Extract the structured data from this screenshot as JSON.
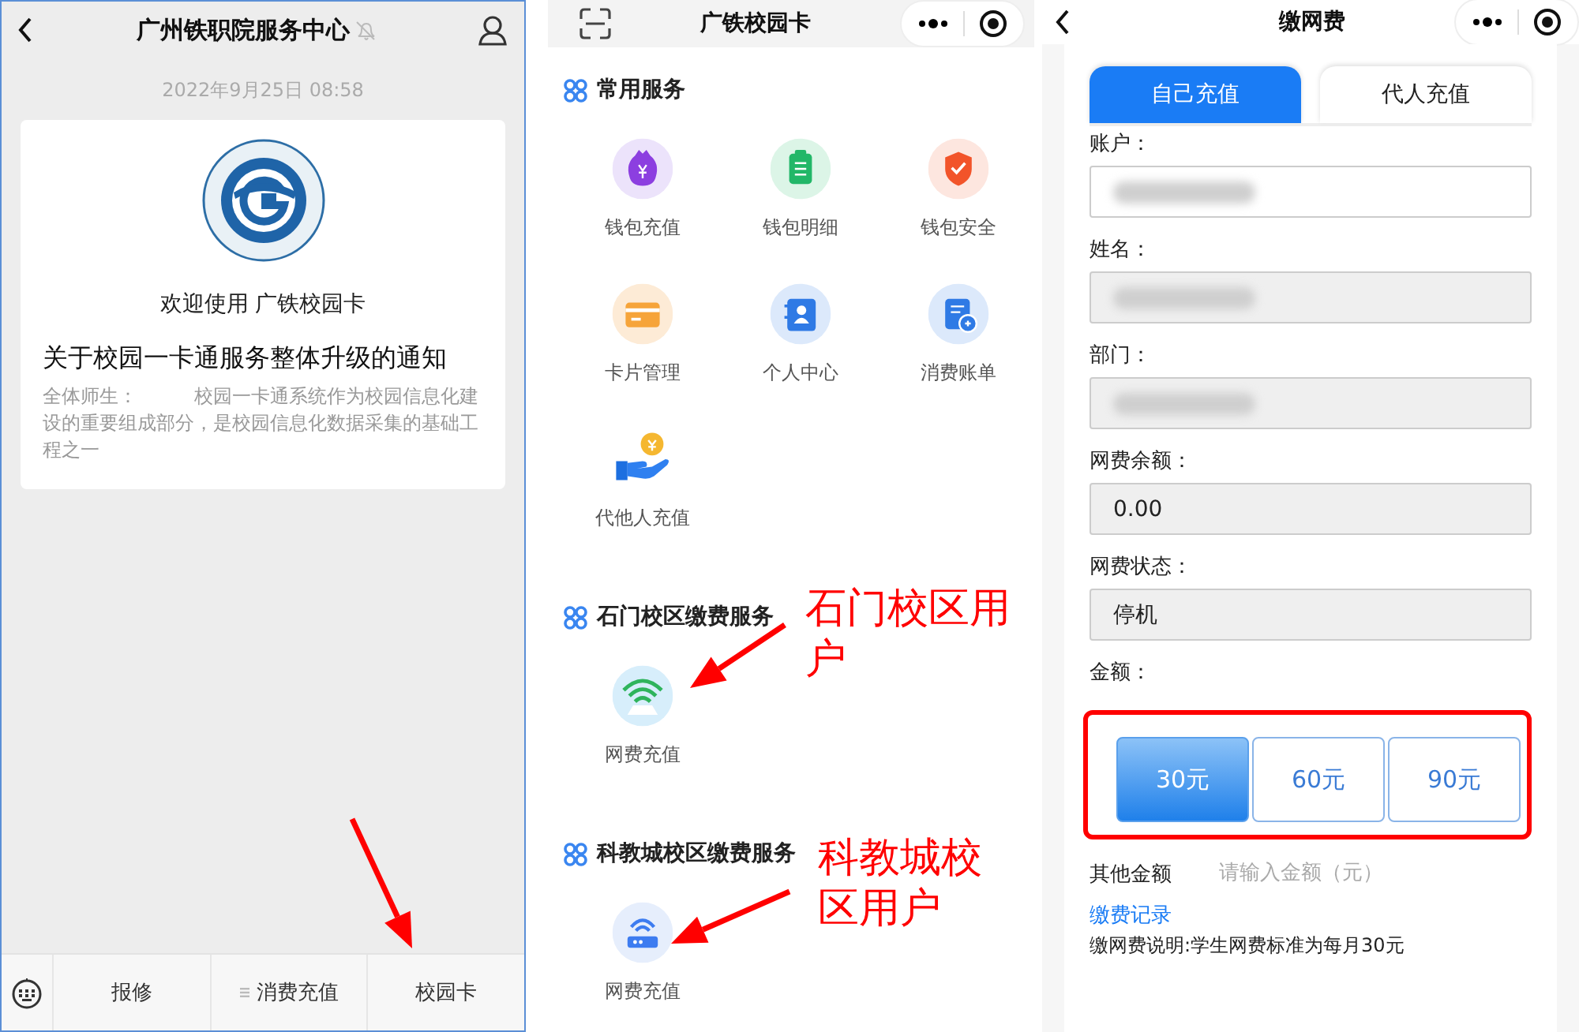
{
  "chat_screen": {
    "title": "广州铁职院服务中心",
    "muted": true,
    "timestamp": "2022年9月25日 08:58",
    "article": {
      "heading": "欢迎使用 广铁校园卡",
      "title": "关于校园一卡通服务整体升级的通知",
      "summary": "全体师生：　　　校园一卡通系统作为校园信息化建设的重要组成部分，是校园信息化数据采集的基础工程之一"
    },
    "menu": [
      {
        "label": "报修",
        "has_submenu": false,
        "pointed": false
      },
      {
        "label": "消费充值",
        "has_submenu": true,
        "pointed": false
      },
      {
        "label": "校园卡",
        "has_submenu": false,
        "pointed": true
      }
    ]
  },
  "card_screen": {
    "title": "广铁校园卡",
    "sections": [
      {
        "title": "常用服务",
        "items": [
          {
            "label": "钱包充值",
            "kind": "wallet"
          },
          {
            "label": "钱包明细",
            "kind": "clipboard"
          },
          {
            "label": "钱包安全",
            "kind": "shield"
          },
          {
            "label": "卡片管理",
            "kind": "card"
          },
          {
            "label": "个人中心",
            "kind": "contact"
          },
          {
            "label": "消费账单",
            "kind": "bill"
          },
          {
            "label": "代他人充值",
            "kind": "hand"
          }
        ]
      },
      {
        "title": "石门校区缴费服务",
        "callout": "石门校区用户",
        "items": [
          {
            "label": "网费充值",
            "kind": "wifi"
          }
        ]
      },
      {
        "title": "科教城校区缴费服务",
        "callout": "科教城校区用户",
        "items": [
          {
            "label": "网费充值",
            "kind": "router"
          }
        ]
      }
    ]
  },
  "pay_screen": {
    "title": "缴网费",
    "tabs": [
      {
        "label": "自己充值",
        "selected": true
      },
      {
        "label": "代人充值",
        "selected": false
      }
    ],
    "fields": [
      {
        "label": "账户：",
        "kind": "editable",
        "redacted": true
      },
      {
        "label": "姓名：",
        "kind": "readonly",
        "redacted": true
      },
      {
        "label": "部门：",
        "kind": "readonly",
        "redacted": true
      },
      {
        "label": "网费余额：",
        "kind": "readonly",
        "redacted": false,
        "value": "0.00"
      },
      {
        "label": "网费状态：",
        "kind": "readonly",
        "redacted": false,
        "value": "停机"
      }
    ],
    "amount_label": "金额：",
    "amounts_highlighted": true,
    "amounts": [
      {
        "label": "30元",
        "selected": true
      },
      {
        "label": "60元",
        "selected": false
      },
      {
        "label": "90元",
        "selected": false
      }
    ],
    "other_amount": {
      "label": "其他金额",
      "placeholder": "请输入金额（元）"
    },
    "records_link": "缴费记录",
    "note": "缴网费说明:学生网费标准为每月30元"
  }
}
